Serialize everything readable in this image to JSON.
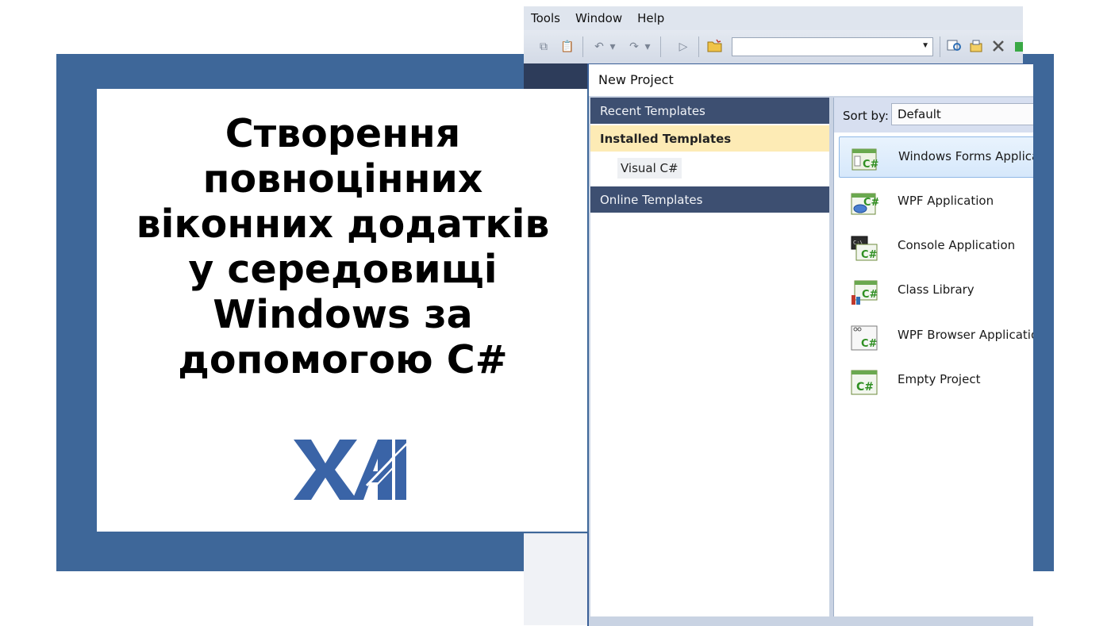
{
  "title_card": {
    "lines": [
      "Створення",
      "повноцінних",
      "віконних додатків",
      "у середовищі",
      "Windows за",
      "допомогою C#"
    ],
    "logo_text": "ХАІ",
    "logo_color": "#3a64a7"
  },
  "ide": {
    "menu": [
      "Tools",
      "Window",
      "Help"
    ],
    "toolbar_combo_value": ""
  },
  "dialog": {
    "title": "New Project",
    "recent_templates": "Recent Templates",
    "installed_templates": "Installed Templates",
    "visual_csharp": "Visual C#",
    "online_templates": "Online Templates",
    "sort_label": "Sort by:",
    "sort_value": "Default",
    "templates": [
      {
        "label": "Windows Forms Application",
        "icon": "windows-forms-icon",
        "selected": true
      },
      {
        "label": "WPF Application",
        "icon": "wpf-application-icon",
        "selected": false
      },
      {
        "label": "Console Application",
        "icon": "console-application-icon",
        "selected": false
      },
      {
        "label": "Class Library",
        "icon": "class-library-icon",
        "selected": false
      },
      {
        "label": "WPF Browser Application",
        "icon": "wpf-browser-icon",
        "selected": false
      },
      {
        "label": "Empty Project",
        "icon": "empty-project-icon",
        "selected": false
      }
    ]
  },
  "colors": {
    "frame_blue": "#3e6799",
    "section_header": "#3d4f71",
    "installed_highlight": "#fdebb5",
    "csharp_green": "#2f8f22"
  }
}
